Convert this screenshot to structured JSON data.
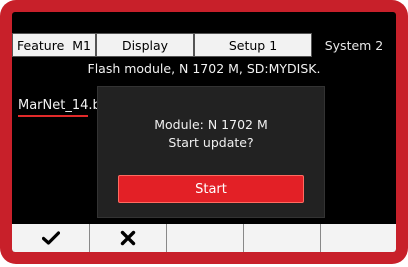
{
  "tabs": [
    {
      "label": "Feature  M1",
      "active": false
    },
    {
      "label": "Display",
      "active": false
    },
    {
      "label": "Setup 1",
      "active": false
    },
    {
      "label": "System 2",
      "active": true
    }
  ],
  "header": {
    "text": "Flash module, N 1702 M, SD:MYDISK."
  },
  "file_list": {
    "selected_file": "MarNet_14.b"
  },
  "dialog": {
    "line1": "Module: N 1702 M",
    "line2": "Start update?",
    "start_label": "Start"
  },
  "softkeys": [
    {
      "icon": "checkmark-icon"
    },
    {
      "icon": "cross-icon"
    },
    {
      "icon": ""
    },
    {
      "icon": ""
    },
    {
      "icon": ""
    }
  ],
  "colors": {
    "bezel": "#c8202a",
    "screen": "#000000",
    "accent": "#e32026",
    "dialog": "#222222"
  }
}
